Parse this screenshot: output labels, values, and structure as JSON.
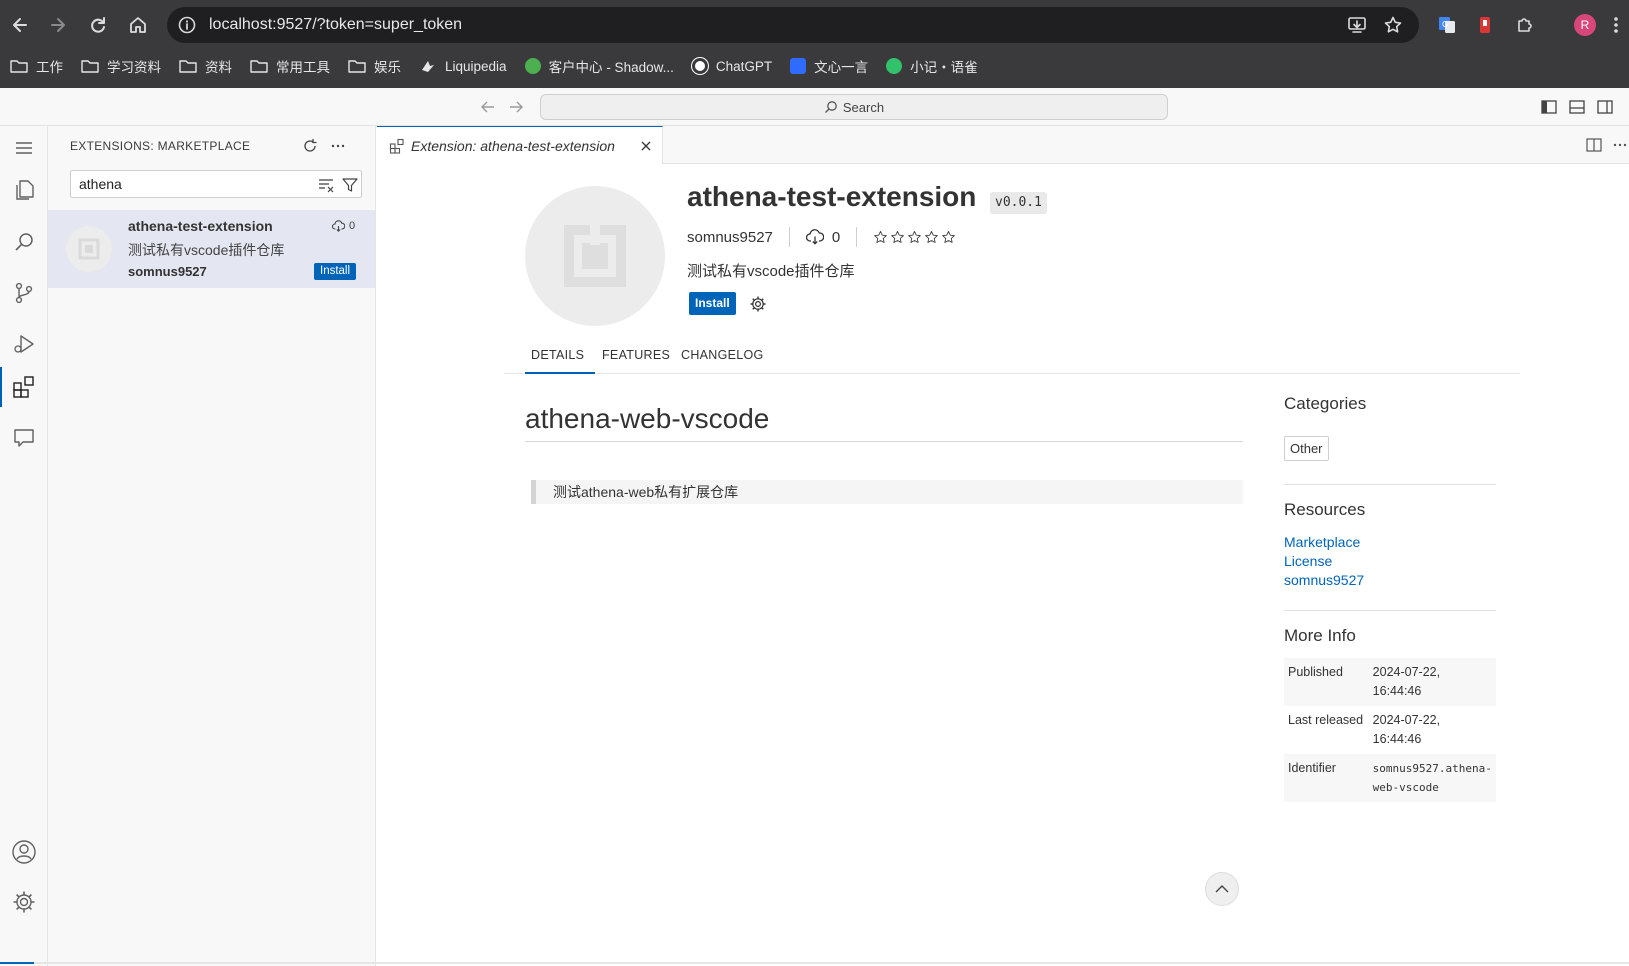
{
  "browser": {
    "url": "localhost:9527/?token=super_token",
    "profile_initial": "R",
    "bookmarks": [
      {
        "label": "工作",
        "icon": "folder-icon"
      },
      {
        "label": "学习资料",
        "icon": "folder-icon"
      },
      {
        "label": "资料",
        "icon": "folder-icon"
      },
      {
        "label": "常用工具",
        "icon": "folder-icon"
      },
      {
        "label": "娱乐",
        "icon": "folder-icon"
      },
      {
        "label": "Liquipedia",
        "icon": "liquipedia-icon"
      },
      {
        "label": "客户中心 - Shadow...",
        "icon": "shadow-icon"
      },
      {
        "label": "ChatGPT",
        "icon": "chatgpt-icon"
      },
      {
        "label": "文心一言",
        "icon": "wenxin-icon"
      },
      {
        "label": "小记・语雀",
        "icon": "yuque-icon"
      }
    ]
  },
  "titlebar": {
    "search_label": "Search"
  },
  "sidebar": {
    "title": "EXTENSIONS: MARKETPLACE",
    "search_value": "athena",
    "item": {
      "name": "athena-test-extension",
      "description": "测试私有vscode插件仓库",
      "publisher": "somnus9527",
      "downloads": "0",
      "install_label": "Install"
    }
  },
  "editor": {
    "tab_label": "Extension: athena-test-extension",
    "extension": {
      "name": "athena-test-extension",
      "version": "v0.0.1",
      "publisher": "somnus9527",
      "downloads": "0",
      "description": "测试私有vscode插件仓库",
      "install_label": "Install",
      "rating_stars": 5
    },
    "detail_tabs": [
      "DETAILS",
      "FEATURES",
      "CHANGELOG"
    ],
    "readme": {
      "title": "athena-web-vscode",
      "quote": "测试athena-web私有扩展仓库"
    },
    "side": {
      "categories_title": "Categories",
      "category": "Other",
      "resources_title": "Resources",
      "resources": [
        "Marketplace",
        "License",
        "somnus9527"
      ],
      "more_info_title": "More Info",
      "info": [
        {
          "key": "Published",
          "value": "2024-07-22, 16:44:46"
        },
        {
          "key": "Last released",
          "value": "2024-07-22, 16:44:46"
        },
        {
          "key": "Identifier",
          "value": "somnus9527.athena-web-vscode"
        }
      ]
    }
  },
  "colors": {
    "accent": "#005fb8",
    "button": "#0064b8",
    "link": "#0064b8",
    "avatar": "#d9467a"
  }
}
